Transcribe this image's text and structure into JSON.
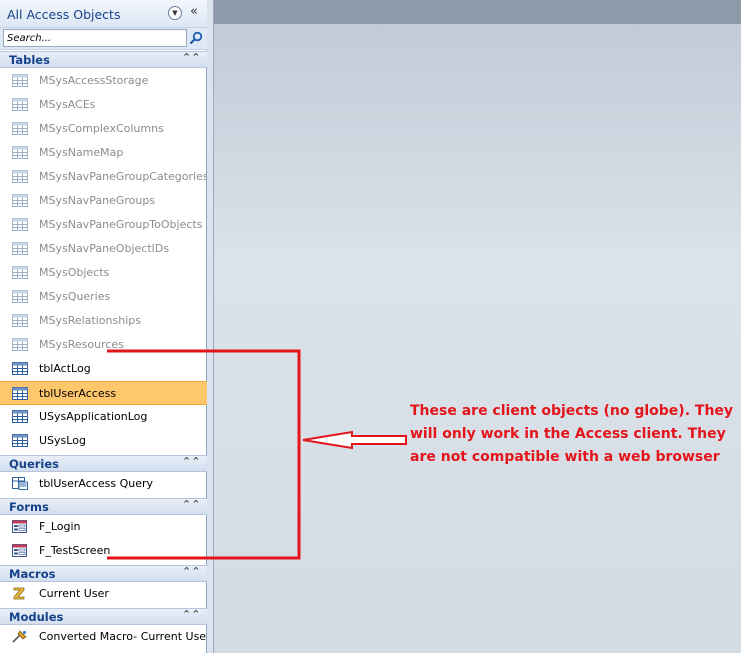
{
  "nav": {
    "title": "All Access Objects",
    "search_placeholder": "Search...",
    "groups": {
      "tables": {
        "label": "Tables",
        "items": [
          "MSysAccessStorage",
          "MSysACEs",
          "MSysComplexColumns",
          "MSysNameMap",
          "MSysNavPaneGroupCategories",
          "MSysNavPaneGroups",
          "MSysNavPaneGroupToObjects",
          "MSysNavPaneObjectIDs",
          "MSysObjects",
          "MSysQueries",
          "MSysRelationships",
          "MSysResources",
          "tblActLog",
          "tblUserAccess",
          "USysApplicationLog",
          "USysLog"
        ]
      },
      "queries": {
        "label": "Queries",
        "items": [
          "tblUserAccess Query"
        ]
      },
      "forms": {
        "label": "Forms",
        "items": [
          "F_Login",
          "F_TestScreen"
        ]
      },
      "macros": {
        "label": "Macros",
        "items": [
          "Current User"
        ]
      },
      "modules": {
        "label": "Modules",
        "items": [
          "Converted Macro- Current User"
        ]
      }
    }
  },
  "annotation": {
    "text": "These are client objects (no globe). They will only work in the Access client. They are not compatible with a web browser"
  },
  "colors": {
    "accent": "#15428b",
    "selection": "#ffc76b",
    "annotation": "#e3151a"
  }
}
